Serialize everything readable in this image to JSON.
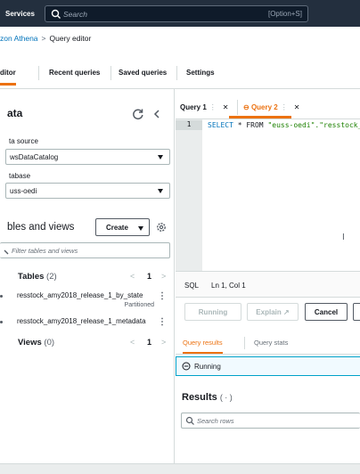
{
  "topbar": {
    "services_label": "Services",
    "search_placeholder": "Search",
    "search_shortcut": "[Option+S]"
  },
  "breadcrumb": {
    "parent": "zon Athena",
    "current": "Query editor"
  },
  "tabs": [
    {
      "label": "ditor",
      "active": true
    },
    {
      "label": "Recent queries",
      "active": false
    },
    {
      "label": "Saved queries",
      "active": false
    },
    {
      "label": "Settings",
      "active": false
    }
  ],
  "left_panel": {
    "title": "ata",
    "data_source_label": "ta source",
    "data_source_value": "wsDataCatalog",
    "database_label": "tabase",
    "database_value": "uss-oedi",
    "tables_views_title": "bles and views",
    "create_button_label": "Create",
    "filter_placeholder": "Filter tables and views",
    "tables_section": {
      "name": "Tables",
      "count": "(2)",
      "page": "1",
      "items": [
        {
          "name": "resstock_amy2018_release_1_by_state",
          "sub": "Partitioned"
        },
        {
          "name": "resstock_amy2018_release_1_metadata",
          "sub": ""
        }
      ]
    },
    "views_section": {
      "name": "Views",
      "count": "(0)",
      "page": "1"
    }
  },
  "right_panel": {
    "query_tabs": [
      {
        "label": "Query 1",
        "active": false
      },
      {
        "label": "Query 2",
        "active": true
      }
    ],
    "editor": {
      "line_number": "1",
      "code_keyword_select": "SELECT",
      "code_rest": " * FROM ",
      "code_string": "\"euss-oedi\".\"resstock_"
    },
    "status": {
      "language": "SQL",
      "position": "Ln 1, Col 1"
    },
    "actions": {
      "running_label": "Running",
      "explain_label": "Explain",
      "cancel_label": "Cancel"
    },
    "result_tabs": [
      {
        "label": "Query results",
        "active": true
      },
      {
        "label": "Query stats",
        "active": false
      }
    ],
    "running_banner": "Running",
    "results_title": "Results",
    "results_count": "( · )",
    "search_rows_placeholder": "Search rows"
  },
  "colors": {
    "topbar": "#232f3e",
    "accent": "#ec7211",
    "link": "#0073bb"
  }
}
